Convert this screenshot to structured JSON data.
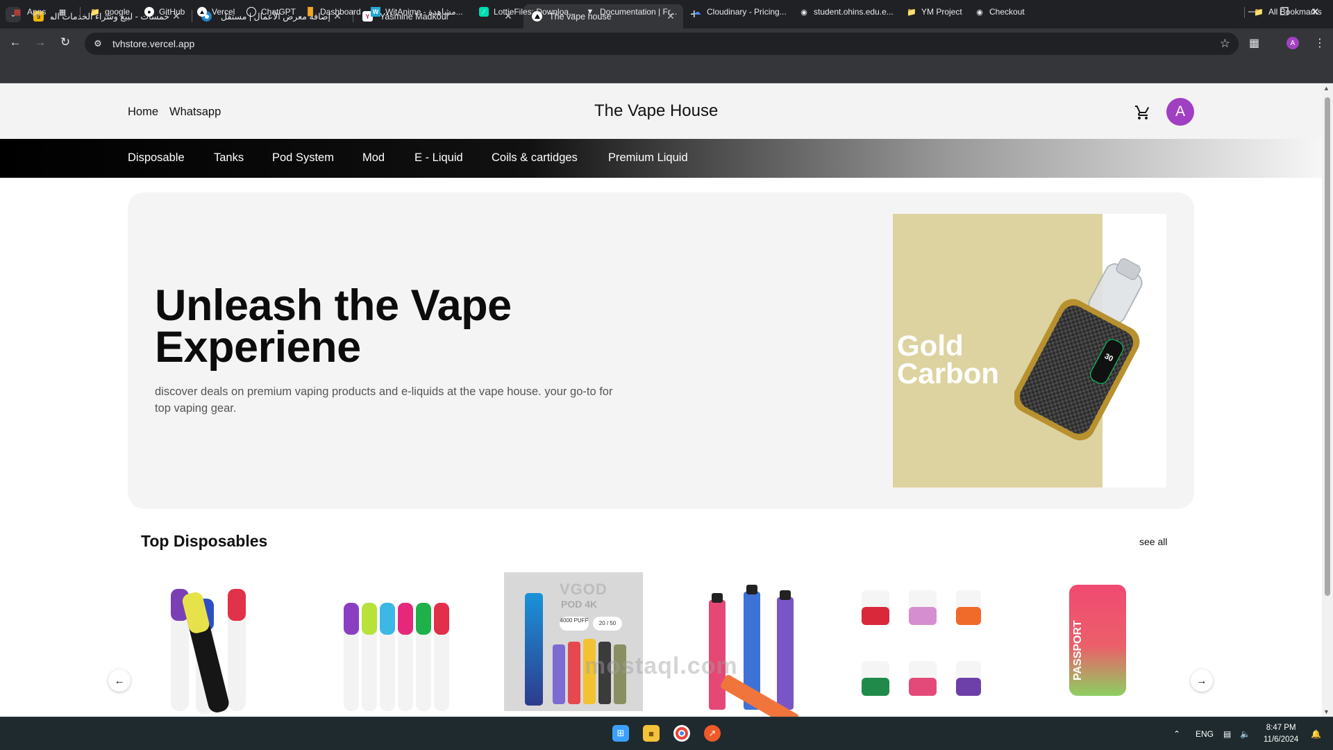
{
  "browser": {
    "tabs": [
      {
        "title": "خمسات - لبيع وشراء الخدمات المصغرة",
        "favicon": "khamsat-icon",
        "active": false
      },
      {
        "title": "إضافة معرض الأعمال | مستقل",
        "favicon": "mostaql-icon",
        "active": false
      },
      {
        "title": "Yasmine Madkour",
        "favicon": "portfolio-icon",
        "active": false
      },
      {
        "title": "The vape house",
        "favicon": "vercel-icon",
        "active": true
      }
    ],
    "url": "tvhstore.vercel.app",
    "profile_initial": "A",
    "bookmarks": [
      {
        "label": "Apps",
        "icon": "apps-grid-icon"
      },
      {
        "label": "google",
        "icon": "folder-icon"
      },
      {
        "label": "GitHub",
        "icon": "github-icon"
      },
      {
        "label": "Vercel",
        "icon": "vercel-icon"
      },
      {
        "label": "ChatGPT",
        "icon": "chatgpt-icon"
      },
      {
        "label": "Dashboard",
        "icon": "dashboard-icon"
      },
      {
        "label": "WitAnime - مشاهدة...",
        "icon": "witanime-icon"
      },
      {
        "label": "LottieFiles: Downloa...",
        "icon": "lottie-icon"
      },
      {
        "label": "Documentation | Fr...",
        "icon": "framer-icon"
      },
      {
        "label": "Cloudinary - Pricing...",
        "icon": "cloudinary-icon"
      },
      {
        "label": "student.ohins.edu.e...",
        "icon": "globe-icon"
      },
      {
        "label": "YM Project",
        "icon": "folder-icon"
      },
      {
        "label": "Checkout",
        "icon": "globe-icon"
      }
    ],
    "all_bookmarks": "All Bookmarks"
  },
  "site": {
    "header": {
      "links": [
        "Home",
        "Whatsapp"
      ],
      "brand": "The Vape House",
      "avatar_initial": "A"
    },
    "categories": [
      "Disposable",
      "Tanks",
      "Pod System",
      "Mod",
      "E - Liquid",
      "Coils & cartidges",
      "Premium Liquid"
    ],
    "hero": {
      "title_line1": "Unleash the Vape",
      "title_line2": "Experiene",
      "subtitle": "discover deals on premium vaping products and e-liquids at the vape house. your go-to for top vaping gear.",
      "image_text_line1": "Gold",
      "image_text_line2": "Carbon"
    },
    "section": {
      "title": "Top Disposables",
      "see_all": "see all"
    },
    "products": [
      {
        "name": "puffco-disposable-set"
      },
      {
        "name": "cloud-nurdz-disposable-set"
      },
      {
        "name": "vgod-pod-4k",
        "brand_text": "VGOD",
        "line": "POD 4K",
        "puffs": "4000 PUFF",
        "mg": "20 / 50"
      },
      {
        "name": "pen-style-disposable-set"
      },
      {
        "name": "box-disposable-set"
      },
      {
        "name": "passport-disposable",
        "label": "PASSPORT"
      }
    ]
  },
  "taskbar": {
    "language": "ENG",
    "time": "8:47 PM",
    "date": "11/6/2024"
  },
  "watermark": "mostaql.com",
  "colors": {
    "accent": "#a13fc3",
    "chrome_dark": "#202124",
    "chrome_mid": "#35363a",
    "hero_panel": "#ddd3a0"
  }
}
